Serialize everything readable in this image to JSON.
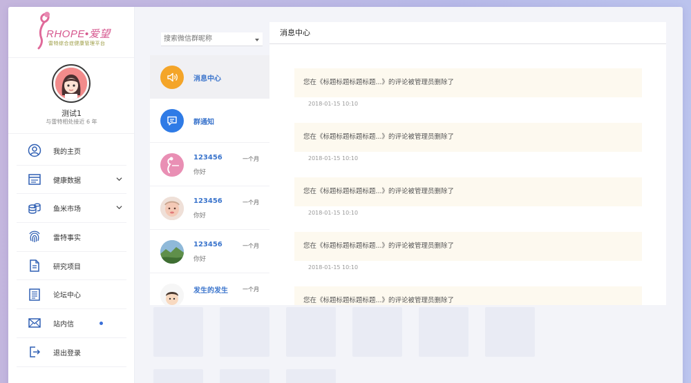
{
  "brand": {
    "name": "RHOPE•爱望",
    "tagline": "雷特综合症健康管理平台",
    "color": "#d6588f"
  },
  "profile": {
    "name": "测试1",
    "subtitle": "与雷特相处接近 6 年"
  },
  "nav": {
    "items": [
      {
        "label": "我的主页",
        "icon": "user-circle-icon"
      },
      {
        "label": "健康数据",
        "icon": "health-data-icon",
        "chevron": true
      },
      {
        "label": "鱼米市场",
        "icon": "coins-icon",
        "chevron": true
      },
      {
        "label": "雷特事实",
        "icon": "fingerprint-icon"
      },
      {
        "label": "研究项目",
        "icon": "document-icon"
      },
      {
        "label": "论坛中心",
        "icon": "forum-icon"
      },
      {
        "label": "站内信",
        "icon": "mail-icon",
        "dot": true
      },
      {
        "label": "退出登录",
        "icon": "logout-icon"
      }
    ]
  },
  "search": {
    "placeholder": "搜索微信群昵称"
  },
  "conversations": [
    {
      "name": "消息中心",
      "icon": "speaker-icon",
      "color": "#f4a529"
    },
    {
      "name": "群通知",
      "icon": "chat-icon",
      "color": "#2f7be6"
    },
    {
      "name": "123456",
      "preview": "你好",
      "time": "一个月",
      "avatar": "brand-logo-avatar"
    },
    {
      "name": "123456",
      "preview": "你好",
      "time": "一个月",
      "avatar": "baby-photo-avatar"
    },
    {
      "name": "123456",
      "preview": "你好",
      "time": "一个月",
      "avatar": "landscape-photo-avatar"
    },
    {
      "name": "发生的发生",
      "time": "一个月",
      "avatar": "cartoon-avatar"
    }
  ],
  "detail": {
    "title": "消息中心",
    "messages": [
      {
        "text": "您在《标题标题标题标题...》的评论被管理员删除了",
        "time": "2018-01-15 10:10"
      },
      {
        "text": "您在《标题标题标题标题...》的评论被管理员删除了",
        "time": "2018-01-15 10:10"
      },
      {
        "text": "您在《标题标题标题标题...》的评论被管理员删除了",
        "time": "2018-01-15 10:10"
      },
      {
        "text": "您在《标题标题标题标题...》的评论被管理员删除了",
        "time": "2018-01-15 10:10"
      },
      {
        "text": "您在《标题标题标题标题...》的评论被管理员删除了"
      }
    ]
  },
  "colors": {
    "accent_blue": "#3a74cc",
    "bubble_bg": "#fdf9ef"
  }
}
